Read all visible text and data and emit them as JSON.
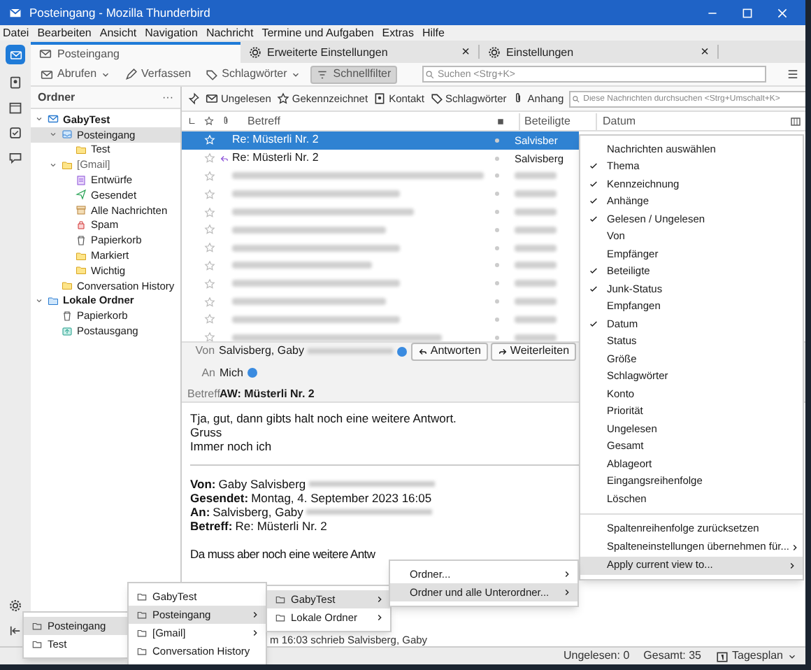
{
  "window": {
    "title": "Posteingang - Mozilla Thunderbird"
  },
  "menubar": [
    "Datei",
    "Bearbeiten",
    "Ansicht",
    "Navigation",
    "Nachricht",
    "Termine und Aufgaben",
    "Extras",
    "Hilfe"
  ],
  "tabs": [
    {
      "label": "Posteingang",
      "selected": true,
      "closable": false
    },
    {
      "label": "Erweiterte Einstellungen",
      "selected": false,
      "closable": true
    },
    {
      "label": "Einstellungen",
      "selected": false,
      "closable": true
    }
  ],
  "close_glyph": "×",
  "toolbar": {
    "get_mail": "Abrufen",
    "compose": "Verfassen",
    "tags": "Schlagwörter",
    "quick_filter": {
      "label": "Schnellfilter",
      "on": true
    },
    "search": {
      "placeholder": "Suchen <Strg+K>"
    }
  },
  "folder_pane": {
    "title": "Ordner",
    "more": "···",
    "folders": [
      {
        "label": "GabyTest",
        "kind": "account",
        "selected": false,
        "children": [
          {
            "label": "Posteingang",
            "kind": "inbox",
            "selected": true,
            "children": [
              {
                "label": "Test",
                "kind": "folder",
                "selected": false
              }
            ]
          },
          {
            "label": "[Gmail]",
            "kind": "folder",
            "selected": false,
            "children": [
              {
                "label": "Entwürfe",
                "kind": "drafts",
                "selected": false
              },
              {
                "label": "Gesendet",
                "kind": "sent",
                "selected": false
              },
              {
                "label": "Alle Nachrichten",
                "kind": "archive",
                "selected": false
              },
              {
                "label": "Spam",
                "kind": "spam",
                "selected": false
              },
              {
                "label": "Papierkorb",
                "kind": "trash",
                "selected": false
              },
              {
                "label": "Markiert",
                "kind": "folder",
                "selected": false
              },
              {
                "label": "Wichtig",
                "kind": "folder",
                "selected": false
              }
            ]
          },
          {
            "label": "Conversation History",
            "kind": "folder",
            "selected": false
          }
        ]
      },
      {
        "label": "Lokale Ordner",
        "kind": "local",
        "selected": false,
        "children": [
          {
            "label": "Papierkorb",
            "kind": "trash",
            "selected": false
          },
          {
            "label": "Postausgang",
            "kind": "outbox",
            "selected": false
          }
        ]
      }
    ]
  },
  "quick_filter_bar": {
    "buttons": [
      "Ungelesen",
      "Gekennzeichnet",
      "Kontakt",
      "Schlagwörter",
      "Anhang"
    ],
    "search": {
      "placeholder": "Diese Nachrichten durchsuchen <Strg+Umschalt+K>"
    }
  },
  "message_list": {
    "columns": [
      "Betreff",
      "Beteiligte",
      "Datum"
    ],
    "rows": [
      {
        "kind": "message",
        "subject": "Re: Müsterli Nr. 2",
        "correspondent": "Salvisber",
        "selected": true,
        "replied": false
      },
      {
        "kind": "message",
        "subject": "Re: Müsterli Nr. 2",
        "correspondent": "Salvisberg",
        "selected": false,
        "replied": true
      },
      {
        "kind": "blurred"
      },
      {
        "kind": "blurred"
      },
      {
        "kind": "blurred"
      },
      {
        "kind": "blurred"
      },
      {
        "kind": "blurred"
      },
      {
        "kind": "blurred"
      },
      {
        "kind": "blurred"
      },
      {
        "kind": "blurred"
      },
      {
        "kind": "blurred"
      },
      {
        "kind": "blurred"
      }
    ]
  },
  "message_header": {
    "from_label": "Von",
    "from": "Salvisberg, Gaby",
    "to_label": "An",
    "to": "Mich",
    "subject_label": "Betreff",
    "subject": "AW: Müsterli Nr. 2",
    "buttons": [
      "Antworten",
      "Weiterleiten"
    ]
  },
  "message_body": {
    "lines": [
      "Tja, gut, dann gibts halt noch eine weitere Antwort.",
      "Gruss",
      "Immer noch ich"
    ],
    "quote_header": [
      {
        "label": "Von:",
        "value": "Gaby Salvisberg",
        "blurred": true
      },
      {
        "label": "Gesendet:",
        "value": "Montag, 4. September 2023 16:05",
        "blurred": false
      },
      {
        "label": "An:",
        "value": "Salvisberg, Gaby",
        "blurred": true
      },
      {
        "label": "Betreff:",
        "value": "Re: Müsterli Nr. 2",
        "blurred": false
      }
    ],
    "heading": "Da muss aber noch eine weitere Antw",
    "partial_line": "m 16:03 schrieb Salvisberg, Gaby"
  },
  "column_menu": {
    "items": [
      {
        "label": "Nachrichten auswählen",
        "checked": false
      },
      {
        "label": "Thema",
        "checked": true
      },
      {
        "label": "Kennzeichnung",
        "checked": true
      },
      {
        "label": "Anhänge",
        "checked": true
      },
      {
        "label": "Gelesen / Ungelesen",
        "checked": true
      },
      {
        "label": "Von",
        "checked": false
      },
      {
        "label": "Empfänger",
        "checked": false
      },
      {
        "label": "Beteiligte",
        "checked": true
      },
      {
        "label": "Junk-Status",
        "checked": true
      },
      {
        "label": "Empfangen",
        "checked": false
      },
      {
        "label": "Datum",
        "checked": true
      },
      {
        "label": "Status",
        "checked": false
      },
      {
        "label": "Größe",
        "checked": false
      },
      {
        "label": "Schlagwörter",
        "checked": false
      },
      {
        "label": "Konto",
        "checked": false
      },
      {
        "label": "Priorität",
        "checked": false
      },
      {
        "label": "Ungelesen",
        "checked": false
      },
      {
        "label": "Gesamt",
        "checked": false
      },
      {
        "label": "Ablageort",
        "checked": false
      },
      {
        "label": "Eingangsreihenfolge",
        "checked": false
      },
      {
        "label": "Löschen",
        "checked": false
      }
    ],
    "actions": [
      {
        "label": "Spaltenreihenfolge zurücksetzen",
        "submenu": false,
        "selected": false
      },
      {
        "label": "Spalteneinstellungen übernehmen für...",
        "submenu": true,
        "selected": false
      },
      {
        "label": "Apply current view to...",
        "submenu": true,
        "selected": true
      }
    ]
  },
  "submenus": [
    {
      "items": [
        {
          "label": "Posteingang",
          "submenu": false,
          "selected": true,
          "icon": true
        },
        {
          "label": "Test",
          "submenu": false,
          "selected": false,
          "icon": true
        }
      ]
    },
    {
      "items": [
        {
          "label": "GabyTest",
          "submenu": false,
          "selected": false,
          "icon": true
        },
        {
          "label": "Posteingang",
          "submenu": true,
          "selected": true,
          "icon": true
        },
        {
          "label": "[Gmail]",
          "submenu": true,
          "selected": false,
          "icon": true
        },
        {
          "label": "Conversation History",
          "submenu": false,
          "selected": false,
          "icon": true
        }
      ]
    },
    {
      "items": [
        {
          "label": "GabyTest",
          "submenu": true,
          "selected": true,
          "icon": true
        },
        {
          "label": "Lokale Ordner",
          "submenu": true,
          "selected": false,
          "icon": true
        }
      ]
    },
    {
      "items": [
        {
          "label": "Ordner...",
          "submenu": true,
          "selected": false,
          "icon": false
        },
        {
          "label": "Ordner und alle Unterordner...",
          "submenu": true,
          "selected": true,
          "icon": false
        }
      ]
    }
  ],
  "status_bar": {
    "unread": "Ungelesen: 0",
    "total": "Gesamt: 35",
    "today_pane": "Tagesplan"
  }
}
